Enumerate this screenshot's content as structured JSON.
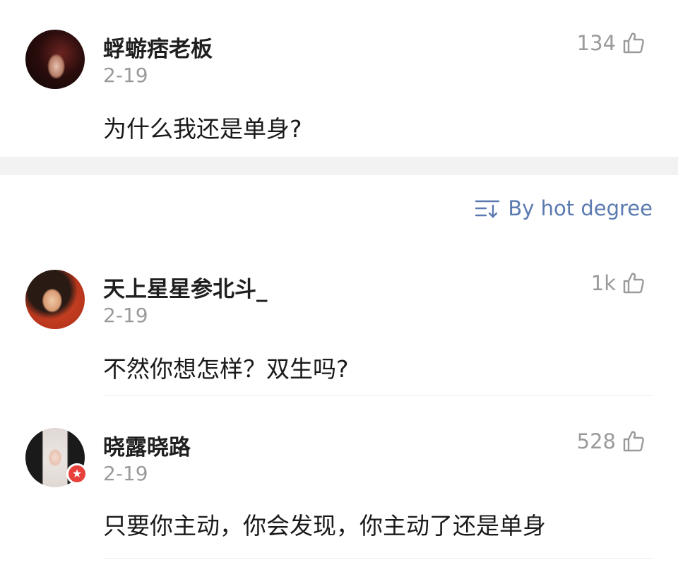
{
  "post": {
    "username": "蜉蝣痞老板",
    "date": "2-19",
    "text": "为什么我还是单身?",
    "likes": "134",
    "avatar_icon": "avatar-image",
    "like_icon": "thumbs-up-icon"
  },
  "sort": {
    "label": "By hot degree",
    "icon": "sort-icon"
  },
  "comments": [
    {
      "username": "天上星星参北斗_",
      "date": "2-19",
      "text": "不然你想怎样？双生吗?",
      "likes": "1k"
    },
    {
      "username": "晓露晓路",
      "date": "2-19",
      "text": "只要你主动，你会发现，你主动了还是单身",
      "likes": "528",
      "badge": "★"
    }
  ],
  "colors": {
    "accent": "#5b7ab0",
    "muted": "#9a9a9a",
    "badge": "#e8403a",
    "separator": "#f2f2f2"
  }
}
